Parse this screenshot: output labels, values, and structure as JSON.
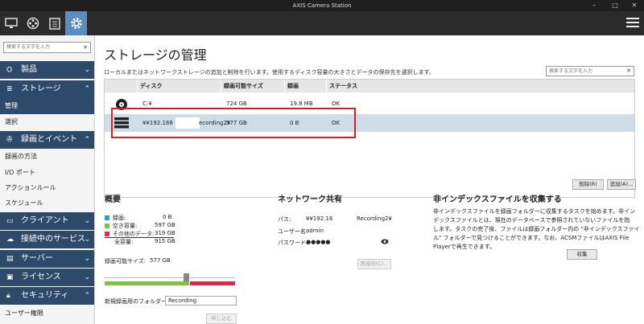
{
  "window": {
    "title": "AXIS Camera Station",
    "min": "–",
    "max": "□",
    "close": "✕"
  },
  "colors": {
    "nav": "#2d4a6b",
    "accent": "#5b8dbf",
    "highlight": "#d21f2b",
    "recording": "#2a9fd6",
    "free": "#7fc241",
    "other": "#e0284a"
  },
  "sidebar": {
    "search_placeholder": "検索する文字を入力",
    "categories": [
      {
        "label": "製品",
        "icon": "camera-product-icon"
      },
      {
        "label": "ストレージ",
        "icon": "database-icon"
      },
      {
        "label": "録画とイベント",
        "icon": "film-reel-icon"
      },
      {
        "label": "クライアント",
        "icon": "monitor-icon"
      },
      {
        "label": "接続中のサービス",
        "icon": "cloud-icon"
      },
      {
        "label": "サーバー",
        "icon": "server-icon"
      },
      {
        "label": "ライセンス",
        "icon": "license-icon"
      },
      {
        "label": "セキュリティ",
        "icon": "lock-icon"
      }
    ],
    "storage_items": [
      "管理",
      "選択"
    ],
    "recording_items": [
      "録画の方法",
      "I/O ポート",
      "アクションルール",
      "スケジュール"
    ],
    "security_items": [
      "ユーザー権限"
    ]
  },
  "main": {
    "title": "ストレージの管理",
    "description": "ローカルまたはネットワークストレージの追加と削除を行います。使用するディスク容量の大きさとデータの保存先を選択します。",
    "search_placeholder": "検索する文字を入力",
    "table": {
      "headers": [
        "ディスク",
        "録画可能サイズ",
        "録画",
        "ステータス"
      ],
      "rows": [
        {
          "disk": "C:¥",
          "size": "724 GB",
          "recording": "19.8 MB",
          "status": "OK"
        },
        {
          "disk_prefix": "¥¥192.168",
          "disk_suffix": "ecording2¥",
          "size": "577 GB",
          "recording": "0 B",
          "status": "OK"
        }
      ]
    },
    "remove_button": "削除(R)",
    "add_button": "追加(A)...",
    "overview": {
      "title": "概要",
      "rows": [
        {
          "label": "録画:",
          "value": "0 B"
        },
        {
          "label": "空き容量:",
          "value": "597 GB"
        },
        {
          "label": "その他のデータ:",
          "value": "319 GB"
        },
        {
          "label": "全容量:",
          "value": "915 GB"
        }
      ],
      "recordable_label": "録画可能サイズ:",
      "recordable_value": "577 GB",
      "folder_label": "新規録画用のフォルダー:",
      "folder_value": "Recording",
      "apply_button": "申し込む"
    },
    "network": {
      "title": "ネットワーク共有",
      "path_label": "パス:",
      "path_value": "¥¥192.16",
      "path_suffix": "Recording2¥",
      "user_label": "ユーザー名:",
      "user_value": "admin",
      "password_label": "パスワード:",
      "password_value": "●●●●●",
      "reconnect_button": "再接続(C)..."
    },
    "collect": {
      "title": "非インデックスファイルを収集する",
      "lines": [
        "非インデックスファイルを録画フォルダーに収集するタスクを始めます。非イン",
        "デックスファイルとは、現在のデータベースで参照されていないファイルを指",
        "します。タスクの完了後、ファイルは録画フォルダー内の \"非インデックスファイ",
        "ル\" フォルダーで見つけることができます。なお、ACSMファイルはAXIS File",
        "Playerで再生できます。"
      ],
      "collect_button": "収集"
    }
  }
}
